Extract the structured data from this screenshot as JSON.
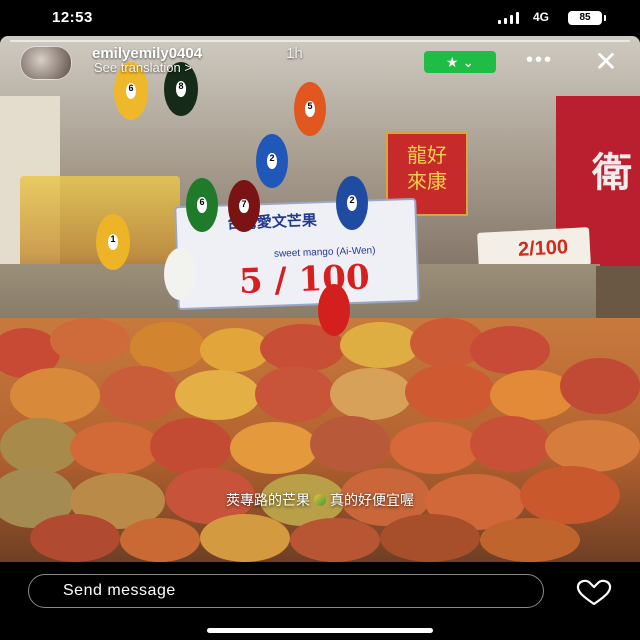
{
  "status_bar": {
    "time": "12:53",
    "network": "4G",
    "battery": "85"
  },
  "story": {
    "username": "emilyemily0404",
    "time_ago": "1h",
    "translation_link": "See translation >",
    "caption_left": "莢專路的芒果",
    "caption_right": "真的好便宜喔",
    "sign": {
      "title": "台灣愛文芒果",
      "subtitle": "sweet mango (Ai-Wen)",
      "price": "5 / 100"
    },
    "banner_chars": [
      "龍",
      "好",
      "來",
      "康"
    ],
    "price_tag_right": "2/100",
    "shop_sign_char": "衛"
  },
  "controls": {
    "favorites_icon": "star-chevron-icon",
    "more_icon": "more-dots-icon",
    "close_icon": "close-icon"
  },
  "footer": {
    "message_placeholder": "Send message",
    "like_icon": "heart-icon"
  },
  "colors": {
    "favorites_green": "#1fbd45",
    "background": "#000000"
  }
}
